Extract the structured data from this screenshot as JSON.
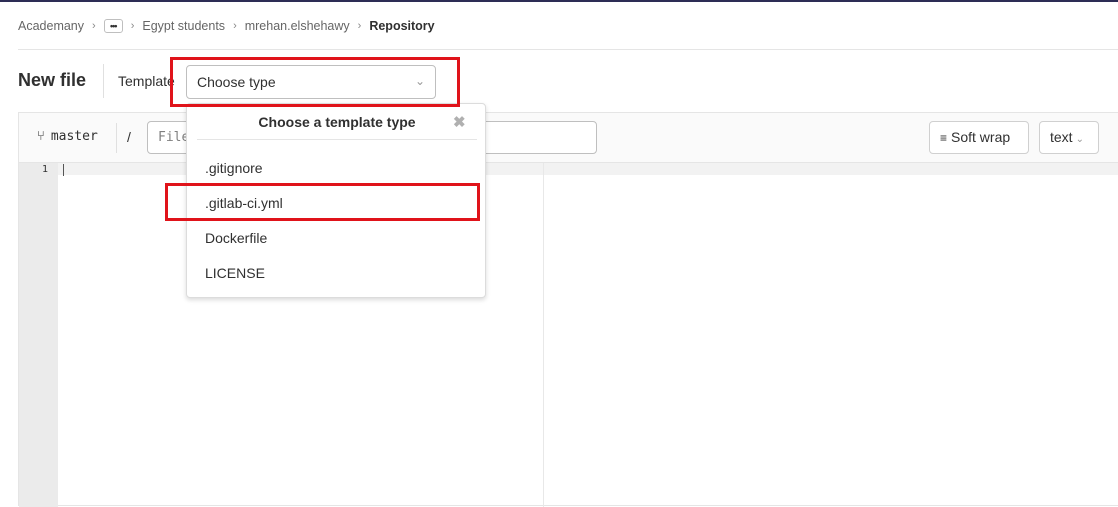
{
  "breadcrumb": {
    "items": [
      "Academany",
      "Egypt students",
      "mrehan.elshehawy",
      "Repository"
    ],
    "more_label": "•••",
    "separator": ">"
  },
  "header": {
    "title": "New file",
    "template_label": "Template",
    "template_select": {
      "value": "Choose type"
    }
  },
  "editor": {
    "branch": "master",
    "path_separator": "/",
    "file_name_placeholder": "File name",
    "soft_wrap_label": "Soft wrap",
    "language": "text",
    "line_numbers": [
      "1"
    ]
  },
  "dropdown": {
    "title": "Choose a template type",
    "items": [
      ".gitignore",
      ".gitlab-ci.yml",
      "Dockerfile",
      "LICENSE"
    ]
  },
  "annotations": {
    "highlight_color": "#e0131a"
  },
  "icons": {
    "fork": "fork-icon",
    "close": "close-icon",
    "chevron": "chevron-down-icon",
    "wrap": "wrap-icon"
  }
}
